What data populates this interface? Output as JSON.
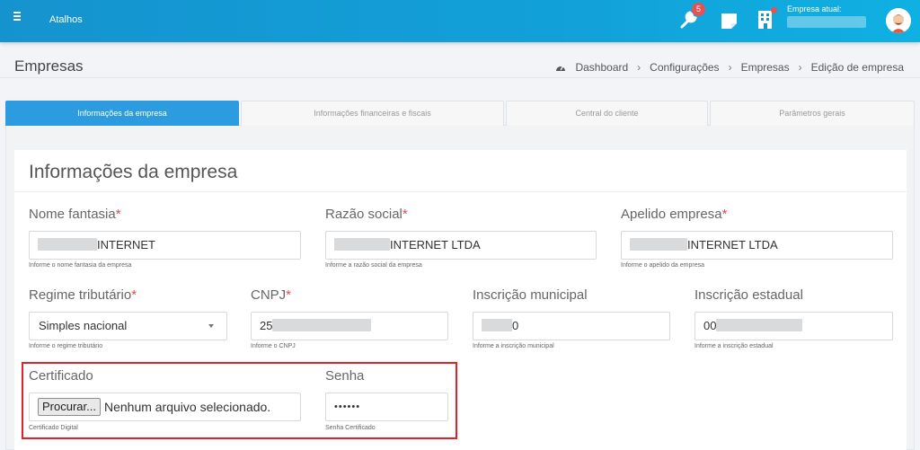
{
  "topbar": {
    "atalhos_label": "Atalhos",
    "badge_count": "5",
    "empresa_label": "Empresa atual:"
  },
  "header": {
    "page_title": "Empresas",
    "breadcrumb": [
      "Dashboard",
      "Configurações",
      "Empresas",
      "Edição de empresa"
    ]
  },
  "tabs": [
    {
      "label": "Informações da empresa",
      "active": true
    },
    {
      "label": "Informações financeiras e fiscais",
      "active": false
    },
    {
      "label": "Central do cliente",
      "active": false
    },
    {
      "label": "Parâmetros gerais",
      "active": false
    }
  ],
  "form": {
    "title": "Informações da empresa",
    "required_mark": "*",
    "nome_fantasia": {
      "label": "Nome fantasia",
      "value": "INTERNET",
      "hint": "Informe o nome fantasia da empresa"
    },
    "razao_social": {
      "label": "Razão social",
      "value": "INTERNET LTDA",
      "hint": "Informe a razão social da empresa"
    },
    "apelido": {
      "label": "Apelido empresa",
      "value": "INTERNET LTDA",
      "hint": "Informe o apelido da empresa"
    },
    "regime": {
      "label": "Regime tributário",
      "value": "Simples nacional",
      "hint": "Informe o regime tributário"
    },
    "cnpj": {
      "label": "CNPJ",
      "value": "25",
      "hint": "Informe o CNPJ"
    },
    "insc_municipal": {
      "label": "Inscrição municipal",
      "value": "0",
      "hint": "Informe a inscrição municipal"
    },
    "insc_estadual": {
      "label": "Inscrição estadual",
      "value": "00",
      "hint": "Informe a inscrição estadual"
    },
    "certificado": {
      "label": "Certificado",
      "button": "Procurar...",
      "status": "Nenhum arquivo selecionado.",
      "hint": "Certificado Digital"
    },
    "senha": {
      "label": "Senha",
      "value": "••••••",
      "hint": "Senha Certificado"
    }
  },
  "colors": {
    "topbar": "#1593cf",
    "active_tab": "#2c9be0",
    "required": "#e04b4b",
    "highlight_box": "#e3202a"
  }
}
